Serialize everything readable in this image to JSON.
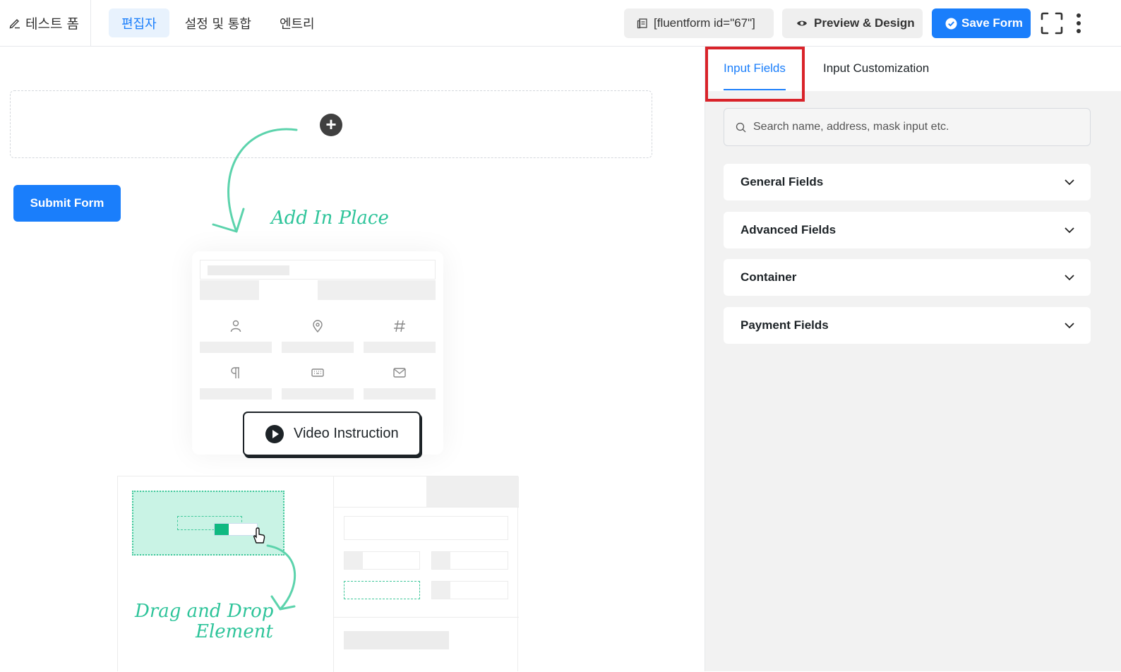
{
  "header": {
    "form_title": "테스트 폼",
    "nav_tabs": [
      {
        "label": "편집자",
        "active": true
      },
      {
        "label": "설정 및 통합",
        "active": false
      },
      {
        "label": "엔트리",
        "active": false
      }
    ],
    "shortcode_label": "[fluentform id=\"67\"]",
    "preview_label": "Preview & Design",
    "save_label": "Save Form",
    "icons": [
      "edit-icon",
      "copy-icon",
      "eye-icon",
      "check-circle-icon",
      "fullscreen-icon",
      "more-vertical-icon"
    ]
  },
  "canvas": {
    "add_in_place": "Add In Place",
    "submit_label": "Submit Form",
    "video_instruction": "Video Instruction",
    "drag_drop_line1": "Drag and Drop",
    "drag_drop_line2": "Element",
    "guide_icons": [
      "user-icon",
      "map-pin-icon",
      "hash-icon",
      "paragraph-icon",
      "keyboard-icon",
      "mail-icon"
    ]
  },
  "panel": {
    "tabs": [
      {
        "label": "Input Fields",
        "active": true
      },
      {
        "label": "Input Customization",
        "active": false
      }
    ],
    "search_placeholder": "Search name, address, mask input etc.",
    "groups": [
      {
        "label": "General Fields"
      },
      {
        "label": "Advanced Fields"
      },
      {
        "label": "Container"
      },
      {
        "label": "Payment Fields"
      }
    ]
  },
  "colors": {
    "accent": "#1a7efb",
    "hint_green": "#2ec49a",
    "highlight_red": "#d9232a"
  }
}
